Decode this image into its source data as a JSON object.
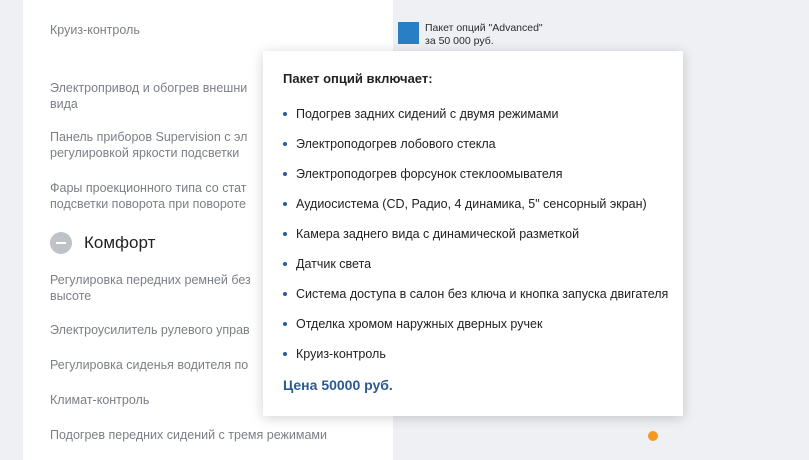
{
  "features": [
    {
      "text": "Круиз-контроль"
    },
    {
      "text": "Электропривод и обогрев внешни\nвида"
    },
    {
      "text": "Панель приборов Supervision с эл\nрегулировкой яркости подсветки"
    },
    {
      "text": "Фары проекционного типа со стат\nподсветки поворота при повороте"
    },
    {
      "text": "Регулировка передних ремней без\nвысоте"
    },
    {
      "text": "Электроусилитель рулевого управ"
    },
    {
      "text": "Регулировка сиденья водителя по"
    },
    {
      "text": "Климат-контроль"
    },
    {
      "text": "Подогрев передних сидений с тремя режимами"
    }
  ],
  "section": {
    "title": "Комфорт",
    "icon": "minus-circle-icon"
  },
  "legend": {
    "line1": "Пакет опций \"Advanced\"",
    "line2": "за 50 000 руб.",
    "color": "#2a7fc4"
  },
  "popup": {
    "title": "Пакет опций включает:",
    "items": [
      "Подогрев задних сидений с двумя режимами",
      "Электроподогрев лобового стекла",
      "Электроподогрев форсунок стеклоомывателя",
      "Аудиосистема (CD, Радио, 4 динамика, 5\" сенсорный экран)",
      "Камера заднего вида с динамической разметкой",
      "Датчик света",
      "Система доступа в салон без ключа и кнопка запуска двигателя",
      "Отделка хромом наружных дверных ручек",
      "Круиз-контроль"
    ],
    "price": "Цена 50000 руб."
  },
  "colors": {
    "accent_orange": "#f39a1f",
    "price_blue": "#2b5b8f"
  }
}
